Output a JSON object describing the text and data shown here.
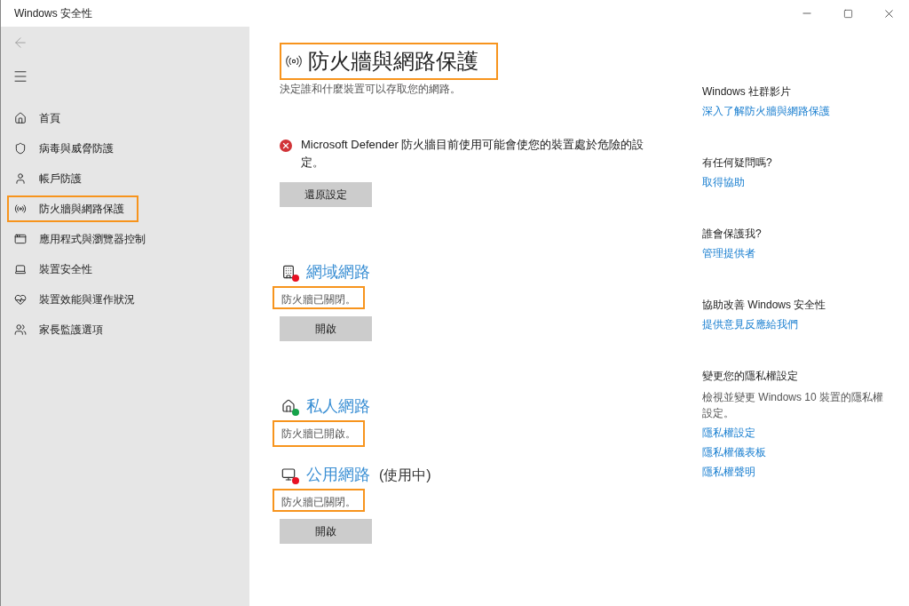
{
  "window": {
    "title": "Windows 安全性"
  },
  "sidebar": {
    "items": [
      {
        "kind": "home",
        "label": "首頁",
        "selected": false
      },
      {
        "kind": "shield",
        "label": "病毒與威脅防護",
        "selected": false
      },
      {
        "kind": "account",
        "label": "帳戶防護",
        "selected": false
      },
      {
        "kind": "antenna",
        "label": "防火牆與網路保護",
        "selected": true
      },
      {
        "kind": "app",
        "label": "應用程式與瀏覽器控制",
        "selected": false
      },
      {
        "kind": "device",
        "label": "裝置安全性",
        "selected": false
      },
      {
        "kind": "health",
        "label": "裝置效能與運作狀況",
        "selected": false
      },
      {
        "kind": "family",
        "label": "家長監護選項",
        "selected": false
      }
    ]
  },
  "page": {
    "title": "防火牆與網路保護",
    "title_highlighted": true,
    "subtitle": "決定誰和什麼裝置可以存取您的網路。",
    "alert": {
      "text": "Microsoft Defender 防火牆目前使用可能會使您的裝置處於危險的設定。",
      "button": "還原設定"
    },
    "networks": [
      {
        "kind": "domain",
        "name": "網域網路",
        "on": false,
        "status": "防火牆已關閉。",
        "highlighted": true,
        "button": "開啟"
      },
      {
        "kind": "private",
        "name": "私人網路",
        "on": true,
        "status": "防火牆已開啟。",
        "highlighted": true
      },
      {
        "kind": "public",
        "name": "公用網路",
        "note": "(使用中)",
        "on": false,
        "status": "防火牆已關閉。",
        "highlighted": true,
        "button": "開啟"
      }
    ]
  },
  "aside": [
    {
      "heading": "Windows 社群影片",
      "links": [
        "深入了解防火牆與網路保護"
      ]
    },
    {
      "heading": "有任何疑問嗎?",
      "links": [
        "取得協助"
      ]
    },
    {
      "heading": "誰會保護我?",
      "links": [
        "管理提供者"
      ]
    },
    {
      "heading": "協助改善 Windows 安全性",
      "links": [
        "提供意見反應給我們"
      ]
    },
    {
      "heading": "變更您的隱私權設定",
      "text": "檢視並變更 Windows 10 裝置的隱私權設定。",
      "links": [
        "隱私權設定",
        "隱私權儀表板",
        "隱私權聲明"
      ]
    }
  ]
}
